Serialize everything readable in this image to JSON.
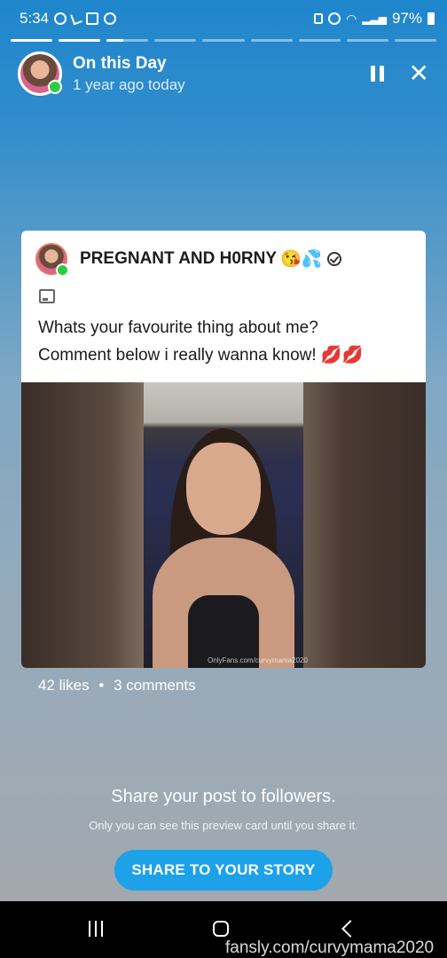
{
  "status_bar": {
    "time": "5:34",
    "battery": "97%"
  },
  "story_progress": {
    "segments": [
      1,
      1,
      0.4,
      0,
      0,
      0,
      0,
      0,
      0
    ]
  },
  "header": {
    "title": "On this Day",
    "subtitle": "1 year ago today",
    "pause_icon": "pause-icon",
    "close_icon": "close-icon",
    "close_glyph": "✕"
  },
  "post": {
    "author": "PREGNANT AND H0RNY",
    "author_emoji": "😘💦",
    "verified_icon": "verified-icon",
    "media_icon": "image-icon",
    "text_line1": "Whats your favourite thing about me?",
    "text_line2": "Comment below i really wanna know!",
    "text_emoji": "💋💋",
    "photo_watermark": "OnlyFans.com/curvymama2020"
  },
  "stats": {
    "likes": "42 likes",
    "separator": "•",
    "comments": "3 comments"
  },
  "share": {
    "title": "Share your post to followers.",
    "subtitle": "Only you can see this preview card until you share it.",
    "button_label": "SHARE TO YOUR STORY"
  },
  "footer_watermark": "fansly.com/curvymama2020",
  "colors": {
    "accent": "#1da1e8",
    "online": "#2ecc40",
    "lips": "#e0218a"
  }
}
